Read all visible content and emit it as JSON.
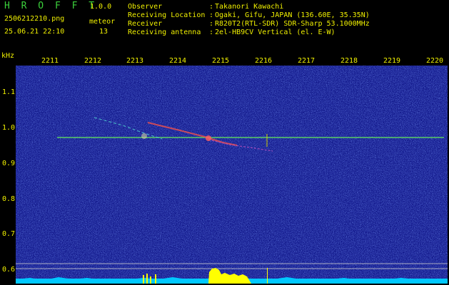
{
  "app": {
    "title": "H R O F F T",
    "version": "1.0.0"
  },
  "file": {
    "name": "2506212210.png",
    "datetime": "25.06.21 22:10"
  },
  "meteor": {
    "label": "meteor",
    "count": "13"
  },
  "info": [
    {
      "label": "Observer",
      "value": "Takanori Kawachi"
    },
    {
      "label": "Receiving Location",
      "value": "Ogaki, Gifu, JAPAN (136.60E, 35.35N)"
    },
    {
      "label": "Receiver",
      "value": "R820T2(RTL-SDR) SDR-Sharp 53.1000MHz"
    },
    {
      "label": "Receiving antenna",
      "value": "2el-HB9CV Vertical (el. E-W)"
    }
  ],
  "colon": ":",
  "axis": {
    "y_title": "kHz",
    "y_ticks": [
      "1.1",
      "1.0",
      "0.9",
      "0.8",
      "0.7",
      "0.6"
    ],
    "x_ticks": [
      "2211",
      "2212",
      "2213",
      "2214",
      "2215",
      "2216",
      "2217",
      "2218",
      "2219",
      "2220"
    ]
  },
  "colors": {
    "background": "#000000",
    "label_yellow": "#f0f000",
    "label_green": "#3cd23c",
    "spectrogram_base": "#12188a",
    "carrier_line": "#60e060",
    "signal_level": "#00c8ff",
    "detection": "#ffff00"
  }
}
